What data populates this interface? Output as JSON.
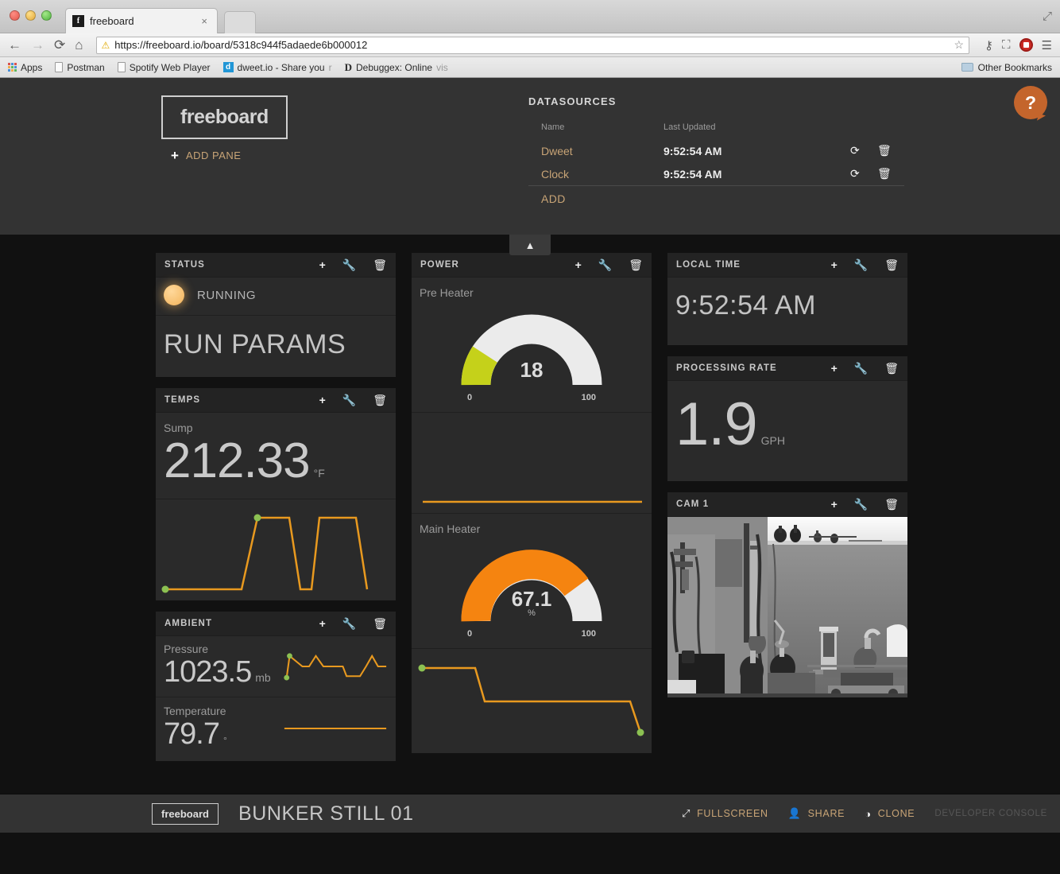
{
  "browser": {
    "tab_title": "freeboard",
    "tab_favicon": "f",
    "tab_close_icon": "×",
    "back_icon": "←",
    "forward_icon": "→",
    "reload_icon": "⟳",
    "home_icon": "⌂",
    "url": "https://freeboard.io/board/5318c944f5adaede6b000012",
    "lock_icon": "⚠",
    "star_icon": "☆",
    "key_icon": "⚷",
    "screenshot_icon": "⛶",
    "menu_icon": "☰",
    "window_expand_icon": "⤢",
    "bookmarks": [
      {
        "label": "Apps",
        "icon": "apps-grid-icon"
      },
      {
        "label": "Postman",
        "icon": "page-icon"
      },
      {
        "label": "Spotify Web Player",
        "icon": "page-icon"
      },
      {
        "label": "dweet.io - Share you",
        "label_faded": "r",
        "icon": "dweet-icon",
        "icon_letter": "d"
      },
      {
        "label": "Debuggex: Online ",
        "label_faded": "vis",
        "icon": "debuggex-icon",
        "icon_letter": "D"
      }
    ],
    "other_bookmarks": "Other Bookmarks"
  },
  "header": {
    "logo": "freeboard",
    "add_pane": "ADD PANE",
    "add_pane_icon": "+",
    "help_icon": "?",
    "datasources": {
      "title": "DATASOURCES",
      "col_name": "Name",
      "col_last_updated": "Last Updated",
      "refresh_icon": "⟳",
      "delete_icon": "🗑",
      "rows": [
        {
          "name": "Dweet",
          "last_updated": "9:52:54 AM"
        },
        {
          "name": "Clock",
          "last_updated": "9:52:54 AM"
        }
      ],
      "add_label": "ADD"
    }
  },
  "collapse_button": {
    "icon": "▲"
  },
  "pane_tools": {
    "add_icon": "+",
    "settings_icon": "🔧",
    "delete_icon": "🗑"
  },
  "panes": {
    "status": {
      "title": "STATUS",
      "indicator_label": "RUNNING",
      "indicator_color": "#f2b35a",
      "text_widget": "RUN PARAMS"
    },
    "temps": {
      "title": "TEMPS",
      "widget_label": "Sump",
      "value": "212.33",
      "unit": "°F",
      "sparkline_color": "#e8991f",
      "point_color": "#8cc152"
    },
    "ambient": {
      "title": "AMBIENT",
      "rows": [
        {
          "label": "Pressure",
          "value": "1023.5",
          "unit": "mb"
        },
        {
          "label": "Temperature",
          "value": "79.7",
          "unit": "°"
        }
      ]
    },
    "power": {
      "title": "POWER",
      "gauges": [
        {
          "label": "Pre Heater",
          "value": "18",
          "unit": "",
          "min": "0",
          "max": "100",
          "percent": 18,
          "color": "#c5d11a"
        },
        {
          "label": "Main Heater",
          "value": "67.1",
          "unit": "%",
          "min": "0",
          "max": "100",
          "percent": 67.1,
          "color": "#f58410"
        }
      ]
    },
    "local_time": {
      "title": "LOCAL TIME",
      "value": "9:52:54 AM"
    },
    "processing_rate": {
      "title": "PROCESSING RATE",
      "value": "1.9",
      "unit": "GPH"
    },
    "cam1": {
      "title": "CAM 1"
    }
  },
  "footer": {
    "logo": "freeboard",
    "board_name": "BUNKER STILL 01",
    "actions": [
      {
        "label": "FULLSCREEN",
        "icon": "⤢"
      },
      {
        "label": "SHARE",
        "icon": "👤"
      },
      {
        "label": "CLONE",
        "icon": "◑"
      }
    ],
    "developer_console": "DEVELOPER CONSOLE"
  },
  "chart_data": [
    {
      "type": "line",
      "name": "temps-sump-sparkline",
      "x": [
        0,
        0.36,
        0.4,
        0.455,
        0.61,
        0.645,
        0.69,
        0.725,
        0.92,
        0.97
      ],
      "y": [
        0.08,
        0.08,
        0.9,
        0.9,
        0.9,
        0.08,
        0.08,
        0.9,
        0.9,
        0.1
      ],
      "ylim": [
        0,
        1
      ],
      "markers": [
        {
          "x": 0.0,
          "y": 0.08
        },
        {
          "x": 0.4,
          "y": 0.9
        }
      ],
      "grid": false,
      "legend": false
    },
    {
      "type": "line",
      "name": "ambient-pressure-sparkline",
      "x": [
        0,
        0.04,
        0.12,
        0.2,
        0.28,
        0.46,
        0.54,
        0.62,
        0.74,
        0.82,
        1.0
      ],
      "y": [
        0.15,
        0.86,
        0.55,
        0.55,
        0.86,
        0.55,
        0.55,
        0.16,
        0.16,
        0.55,
        0.9,
        0.55
      ],
      "ylim": [
        0,
        1
      ],
      "markers": [
        {
          "x": 0.0,
          "y": 0.15
        },
        {
          "x": 0.04,
          "y": 0.86
        }
      ],
      "grid": false,
      "legend": false
    },
    {
      "type": "line",
      "name": "ambient-temperature-sparkline",
      "x": [
        0,
        1
      ],
      "y": [
        0.5,
        0.5
      ],
      "ylim": [
        0,
        1
      ],
      "grid": false,
      "legend": false
    },
    {
      "type": "line",
      "name": "power-preheater-sparkline",
      "x": [
        0,
        1
      ],
      "y": [
        0.1,
        0.1
      ],
      "ylim": [
        0,
        1
      ],
      "grid": false,
      "legend": false
    },
    {
      "type": "line",
      "name": "power-mainheater-sparkline",
      "x": [
        0,
        0.25,
        0.3,
        0.905,
        0.955
      ],
      "y": [
        0.85,
        0.85,
        0.52,
        0.52,
        0.15
      ],
      "ylim": [
        0,
        1
      ],
      "markers": [
        {
          "x": 0.0,
          "y": 0.85
        },
        {
          "x": 0.955,
          "y": 0.15
        }
      ],
      "grid": false,
      "legend": false
    },
    {
      "type": "gauge",
      "name": "pre-heater-gauge",
      "title": "Pre Heater",
      "value": 18,
      "min": 0,
      "max": 100,
      "unit": "",
      "color": "#c5d11a"
    },
    {
      "type": "gauge",
      "name": "main-heater-gauge",
      "title": "Main Heater",
      "value": 67.1,
      "min": 0,
      "max": 100,
      "unit": "%",
      "color": "#f58410"
    }
  ]
}
